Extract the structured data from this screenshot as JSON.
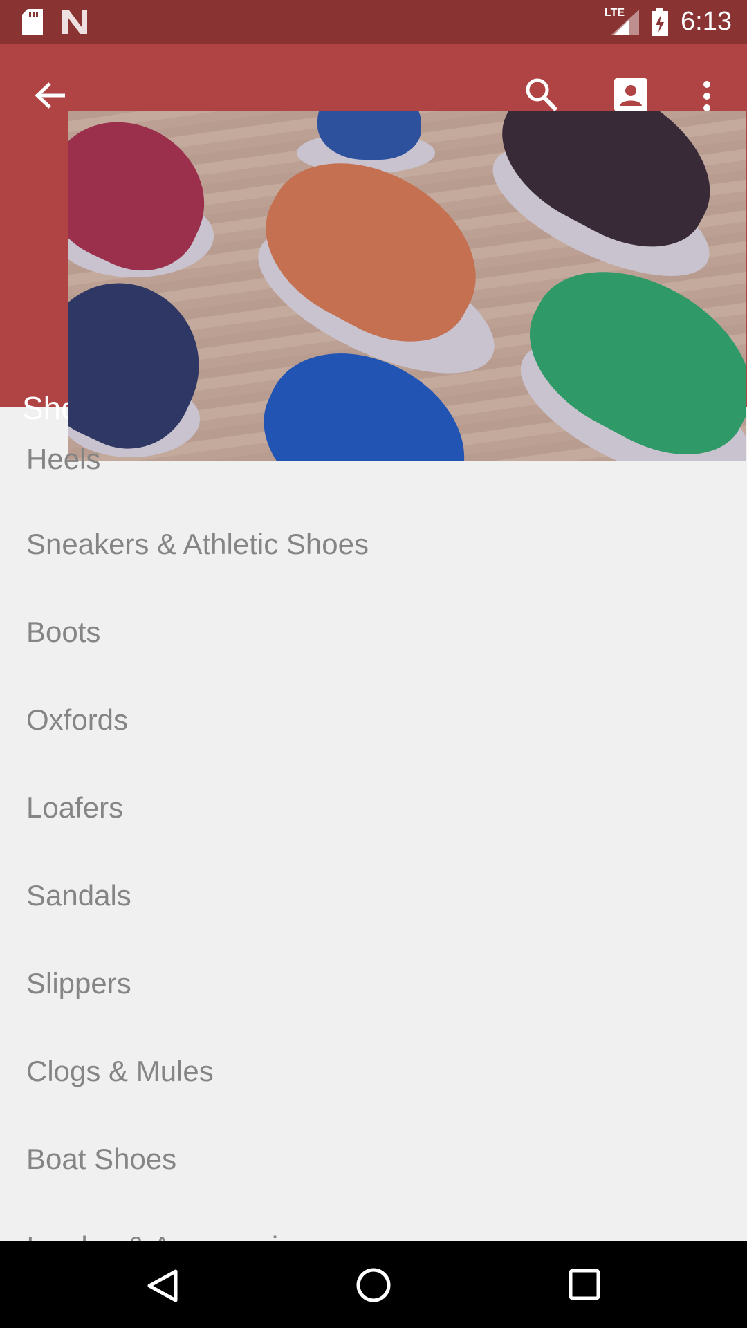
{
  "status_bar": {
    "time": "6:13",
    "network": "LTE",
    "icons": [
      "sd-card-icon",
      "n-icon",
      "lte-signal-icon",
      "battery-charging-icon"
    ]
  },
  "toolbar": {
    "title": "Shoes",
    "icons": [
      "back-arrow-icon",
      "search-icon",
      "account-box-icon",
      "more-vert-icon"
    ]
  },
  "hero_image": {
    "description_alt": "sneakers"
  },
  "categories": [
    "Heels",
    "Sneakers & Athletic Shoes",
    "Boots",
    "Oxfords",
    "Loafers",
    "Sandals",
    "Slippers",
    "Clogs & Mules",
    "Boat Shoes",
    "Insoles & Accessories"
  ],
  "nav_bar": {
    "icons": [
      "back-triangle-icon",
      "home-circle-icon",
      "recents-square-icon"
    ]
  },
  "colors": {
    "status_bar": "#8a3333",
    "toolbar": "#b04343",
    "background": "#f0f0f0",
    "list_text": "#858585"
  }
}
